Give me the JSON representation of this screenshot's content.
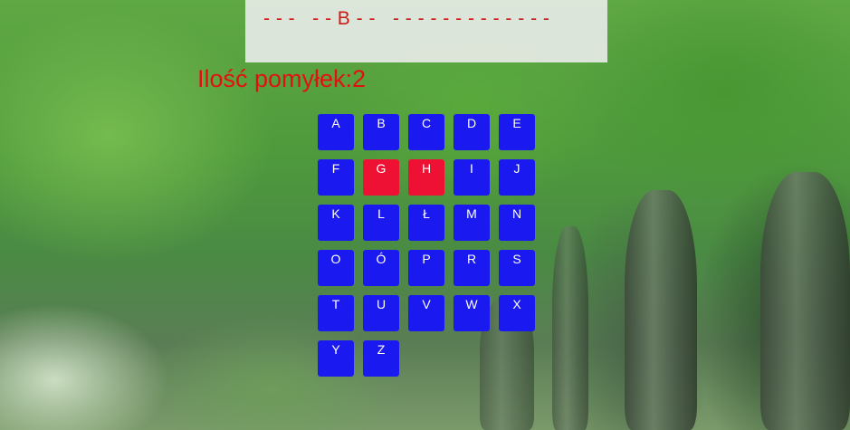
{
  "game": {
    "word_display": "- - -   - - B - -   - - - - - - - - - - - - -",
    "mistakes_text": "Ilość pomyłek:2"
  },
  "colors": {
    "key_default": "#1a1af0",
    "key_used": "#ee1133",
    "word_color": "#cc1a1a",
    "mistakes_color": "#e41010"
  },
  "keyboard": {
    "keys": [
      {
        "label": "A",
        "used": false
      },
      {
        "label": "B",
        "used": false
      },
      {
        "label": "C",
        "used": false
      },
      {
        "label": "D",
        "used": false
      },
      {
        "label": "E",
        "used": false
      },
      {
        "label": "F",
        "used": false
      },
      {
        "label": "G",
        "used": true
      },
      {
        "label": "H",
        "used": true
      },
      {
        "label": "I",
        "used": false
      },
      {
        "label": "J",
        "used": false
      },
      {
        "label": "K",
        "used": false
      },
      {
        "label": "L",
        "used": false
      },
      {
        "label": "Ł",
        "used": false
      },
      {
        "label": "M",
        "used": false
      },
      {
        "label": "N",
        "used": false
      },
      {
        "label": "O",
        "used": false
      },
      {
        "label": "Ó",
        "used": false
      },
      {
        "label": "P",
        "used": false
      },
      {
        "label": "R",
        "used": false
      },
      {
        "label": "S",
        "used": false
      },
      {
        "label": "T",
        "used": false
      },
      {
        "label": "U",
        "used": false
      },
      {
        "label": "V",
        "used": false
      },
      {
        "label": "W",
        "used": false
      },
      {
        "label": "X",
        "used": false
      },
      {
        "label": "Y",
        "used": false
      },
      {
        "label": "Z",
        "used": false
      }
    ]
  }
}
